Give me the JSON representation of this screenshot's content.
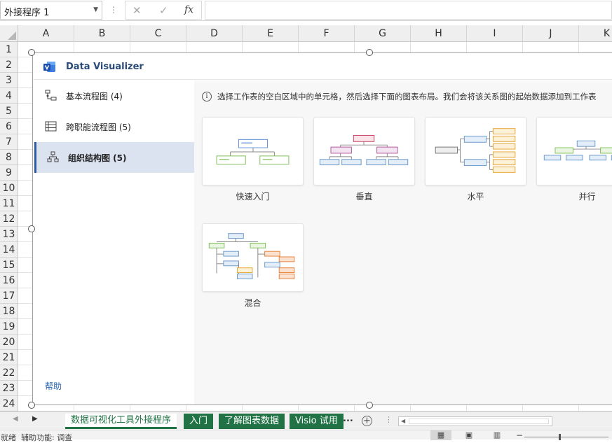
{
  "formula_bar": {
    "name_box": "外接程序 1",
    "cancel_glyph": "✕",
    "enter_glyph": "✓",
    "fx_label": "fx",
    "formula": ""
  },
  "columns": [
    "A",
    "B",
    "C",
    "D",
    "E",
    "F",
    "G",
    "H",
    "I",
    "J",
    "K"
  ],
  "rows": [
    "1",
    "2",
    "3",
    "4",
    "5",
    "6",
    "7",
    "8",
    "9",
    "10",
    "11",
    "12",
    "13",
    "14",
    "15",
    "16",
    "17",
    "18",
    "19",
    "20",
    "21",
    "22",
    "23",
    "24"
  ],
  "panel": {
    "title": "Data Visualizer",
    "sidebar": [
      {
        "label": "基本流程图 (4)",
        "icon": "basic-flowchart-icon",
        "active": false
      },
      {
        "label": "跨职能流程图 (5)",
        "icon": "cross-functional-flowchart-icon",
        "active": false
      },
      {
        "label": "组织结构图 (5)",
        "icon": "org-chart-icon",
        "active": true
      }
    ],
    "help_label": "帮助",
    "info_text": "选择工作表的空白区域中的单元格，然后选择下面的图表布局。我们会将该关系图的起始数据添加到工作表",
    "templates": [
      {
        "label": "快速入门"
      },
      {
        "label": "垂直"
      },
      {
        "label": "水平"
      },
      {
        "label": "并行"
      },
      {
        "label": "混合"
      }
    ]
  },
  "sheet_tabs": [
    {
      "label": "数据可视化工具外接程序",
      "active": true
    },
    {
      "label": "入门",
      "active": false
    },
    {
      "label": "了解图表数据",
      "active": false
    },
    {
      "label": "Visio 试用",
      "active": false
    }
  ],
  "more_tabs": "...",
  "status": {
    "ready": "就绪",
    "accessibility": "辅助功能: 调查"
  },
  "colors": {
    "accent_green": "#217346",
    "panel_active": "#dbe3f1",
    "panel_accent": "#2d5aa5",
    "link_blue": "#2566b5"
  }
}
